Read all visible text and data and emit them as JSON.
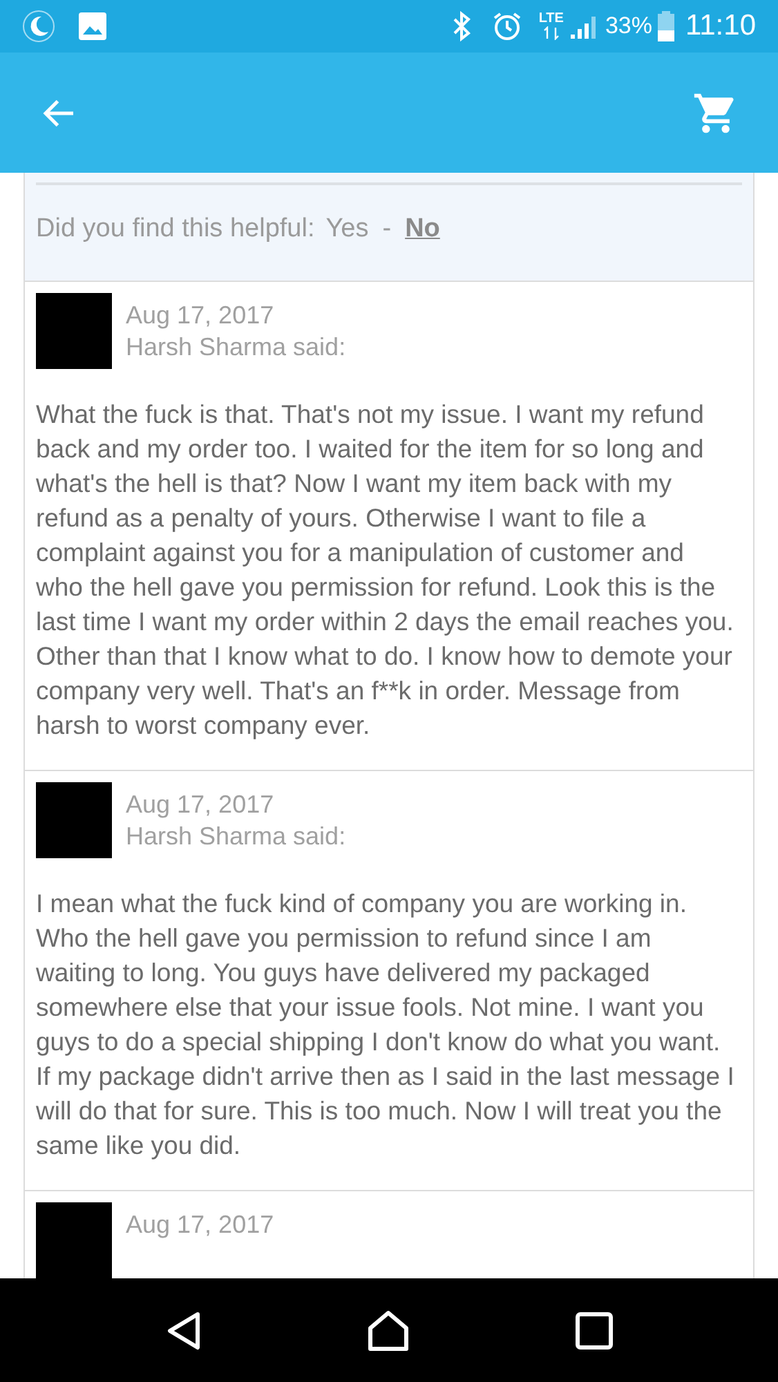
{
  "status_bar": {
    "network": "LTE",
    "battery": "33%",
    "time": "11:10"
  },
  "helpful": {
    "question": "Did you find this helpful:",
    "options": [
      {
        "label": "Yes",
        "selected": false
      },
      {
        "label": "No",
        "selected": true
      }
    ],
    "separator": "-"
  },
  "comments": [
    {
      "date": "Aug 17, 2017",
      "author": "Harsh Sharma said:",
      "body": "What the fuck is that. That's not my issue. I want my refund back and my order too. I waited for the item for so long and what's the hell is that? Now I want my item back with my refund as a penalty of yours. Otherwise I want to file a complaint against you for a manipulation of customer and who the hell gave you permission for refund. Look this is the last time I want my order within 2 days the email reaches you. Other than that I know what to do. I know how to demote your company very well. That's an f**k in order. Message from harsh to worst company ever."
    },
    {
      "date": "Aug 17, 2017",
      "author": "Harsh Sharma said:",
      "body": "I mean what the fuck kind of company you are working in. Who the hell gave you permission to refund since I am waiting to long. You guys have delivered my packaged somewhere else that your issue fools. Not mine. I want you guys to do a special shipping I don't know do what you want. If my package didn't arrive then as I said in the last message I will do that for sure. This is too much. Now I will treat you the same like you did."
    },
    {
      "date": "Aug 17, 2017"
    }
  ]
}
